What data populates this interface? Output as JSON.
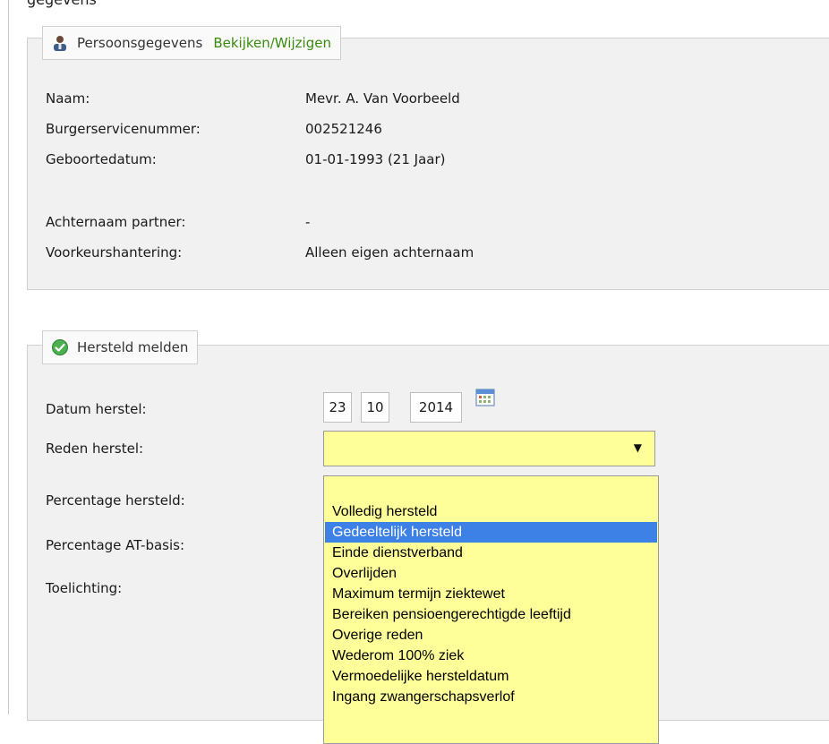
{
  "top_fragment": "gegevens",
  "personal": {
    "title": "Persoonsgegevens",
    "link": "Bekijken/Wijzigen",
    "rows": [
      {
        "label": "Naam:",
        "value": "Mevr. A. Van Voorbeeld"
      },
      {
        "label": "Burgerservicenummer:",
        "value": "002521246"
      },
      {
        "label": "Geboortedatum:",
        "value": "01-01-1993 (21 Jaar)"
      },
      {
        "label": "Achternaam partner:",
        "value": "-"
      },
      {
        "label": "Voorkeurshantering:",
        "value": "Alleen eigen achternaam"
      }
    ]
  },
  "recovery": {
    "title": "Hersteld melden",
    "fields": {
      "date_label": "Datum herstel:",
      "day": "23",
      "month": "10",
      "year": "2014",
      "reason_label": "Reden herstel:",
      "reason_value": "",
      "percentage_label": "Percentage hersteld:",
      "at_basis_label": "Percentage AT-basis:",
      "comment_label": "Toelichting:"
    },
    "options": [
      "",
      "Volledig hersteld",
      "Gedeeltelijk hersteld",
      "Einde dienstverband",
      "Overlijden",
      "Maximum termijn ziektewet",
      "Bereiken pensioengerechtigde leeftijd",
      "Overige reden",
      "Wederom 100% ziek",
      "Vermoedelijke hersteldatum",
      "Ingang zwangerschapsverlof"
    ],
    "selected_option": "Gedeeltelijk hersteld"
  },
  "colors": {
    "link_green": "#3a8a0e",
    "select_yellow": "#ffff99",
    "highlight_blue": "#3d80e6"
  },
  "icons": {
    "personal": "person-icon",
    "recovery": "check-circle-icon",
    "calendar": "calendar-icon",
    "dropdown": "dropdown-arrow-icon"
  }
}
